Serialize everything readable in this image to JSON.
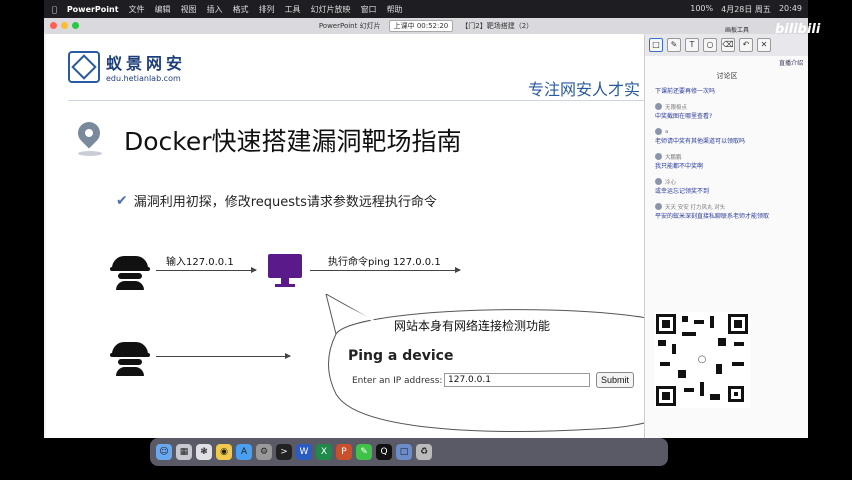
{
  "menubar": {
    "app": "PowerPoint",
    "items": [
      "文件",
      "编辑",
      "视图",
      "插入",
      "格式",
      "排列",
      "工具",
      "幻灯片放映",
      "窗口",
      "帮助"
    ],
    "battery": "100%",
    "date": "4月28日 周五",
    "time": "20:49"
  },
  "titlebar": {
    "app_title": "PowerPoint 幻灯片",
    "timer": "上课中 00:52:20",
    "file_title": "【门2】靶场搭建（2）"
  },
  "slide": {
    "logo_cn": "蚁景网安",
    "logo_en": "edu.hetianlab.com",
    "tagline": "专注网安人才实",
    "title": "Docker快速搭建漏洞靶场指南",
    "subtitle": "漏洞利用初探，修改requests请求参数远程执行命令",
    "label_input": "输入127.0.0.1",
    "label_exec": "执行命令ping 127.0.0.1",
    "bubble_text": "网站本身有网络连接检测功能",
    "ping_title": "Ping a device",
    "ping_label": "Enter an IP address:",
    "ping_value": "127.0.0.1",
    "ping_submit": "Submit"
  },
  "panel": {
    "toolbar_label": "画板工具",
    "live_link": "直播介绍",
    "chat_title": "讨论区",
    "messages": [
      {
        "user": "",
        "text": "下课前还要再修一次吗"
      },
      {
        "user": "无限极点",
        "text": "中奖截图在哪里查看?"
      },
      {
        "user": "a",
        "text": "老师请中奖有其他渠道可以领取吗"
      },
      {
        "user": "大鹏鹏",
        "text": "我只能都不中奖啊"
      },
      {
        "user": "冷心",
        "text": "或幸运忘记领奖不到"
      },
      {
        "user": "天天 安安 打力风丸 对头",
        "text": "平安的蚁米深刻直接私聊联系老师才能领取"
      }
    ]
  },
  "overlay": {
    "bilibili": "bilibili"
  },
  "dock": {
    "items": [
      "finder-icon",
      "launchpad-icon",
      "safari-icon",
      "chrome-icon",
      "app-store-icon",
      "settings-icon",
      "terminal-icon",
      "word-icon",
      "excel-icon",
      "powerpoint-icon",
      "wechat-icon",
      "qq-icon",
      "folder-icon",
      "trash-icon"
    ]
  },
  "colors": {
    "brand_blue": "#2a5aa0",
    "monitor_purple": "#5a1a8a",
    "chat_text": "#2a3a9a"
  }
}
